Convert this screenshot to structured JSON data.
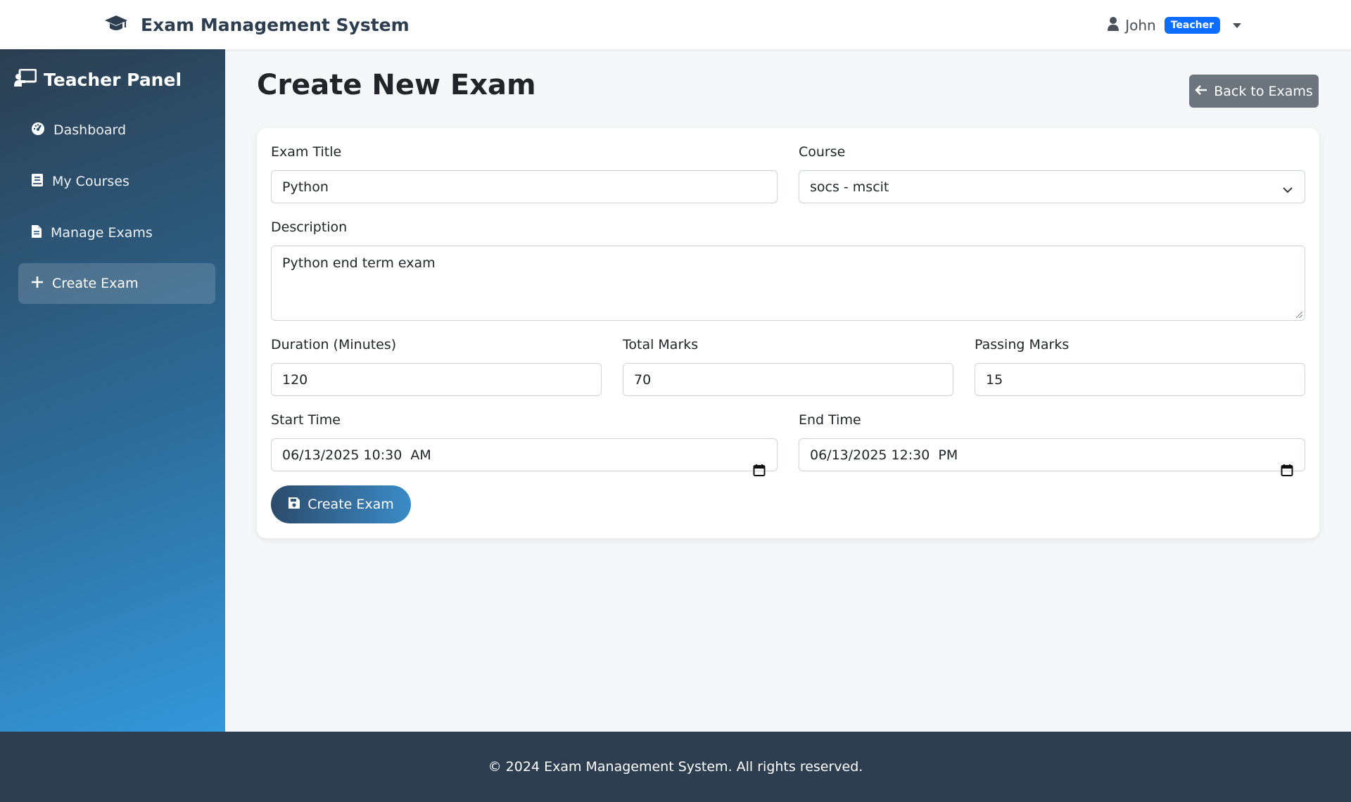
{
  "navbar": {
    "brand_title": "Exam Management System",
    "brand_icon": "graduation-cap-icon",
    "user_name": "John",
    "role_badge": "Teacher"
  },
  "sidebar": {
    "panel_title": "Teacher Panel",
    "items": [
      {
        "label": "Dashboard",
        "icon": "tachometer-icon",
        "active": false
      },
      {
        "label": "My Courses",
        "icon": "book-icon",
        "active": false
      },
      {
        "label": "Manage Exams",
        "icon": "file-icon",
        "active": false
      },
      {
        "label": "Create Exam",
        "icon": "plus-icon",
        "active": true
      }
    ]
  },
  "main": {
    "page_title": "Create New Exam",
    "back_button": "Back to Exams"
  },
  "form": {
    "exam_title_label": "Exam Title",
    "exam_title_value": "Python",
    "course_label": "Course",
    "course_value": "socs - mscit",
    "description_label": "Description",
    "description_value": "Python end term exam",
    "duration_label": "Duration (Minutes)",
    "duration_value": "120",
    "total_marks_label": "Total Marks",
    "total_marks_value": "70",
    "passing_marks_label": "Passing Marks",
    "passing_marks_value": "15",
    "start_time_label": "Start Time",
    "start_time_value": "06/13/2025 10:30  AM",
    "end_time_label": "End Time",
    "end_time_value": "06/13/2025 12:30  PM",
    "submit_label": "Create Exam"
  },
  "footer": {
    "text": "© 2024 Exam Management System. All rights reserved."
  },
  "colors": {
    "brand_dark": "#2c3e50",
    "accent_blue": "#3498db",
    "badge_blue": "#0d6efd",
    "secondary_gray": "#6c757d"
  }
}
